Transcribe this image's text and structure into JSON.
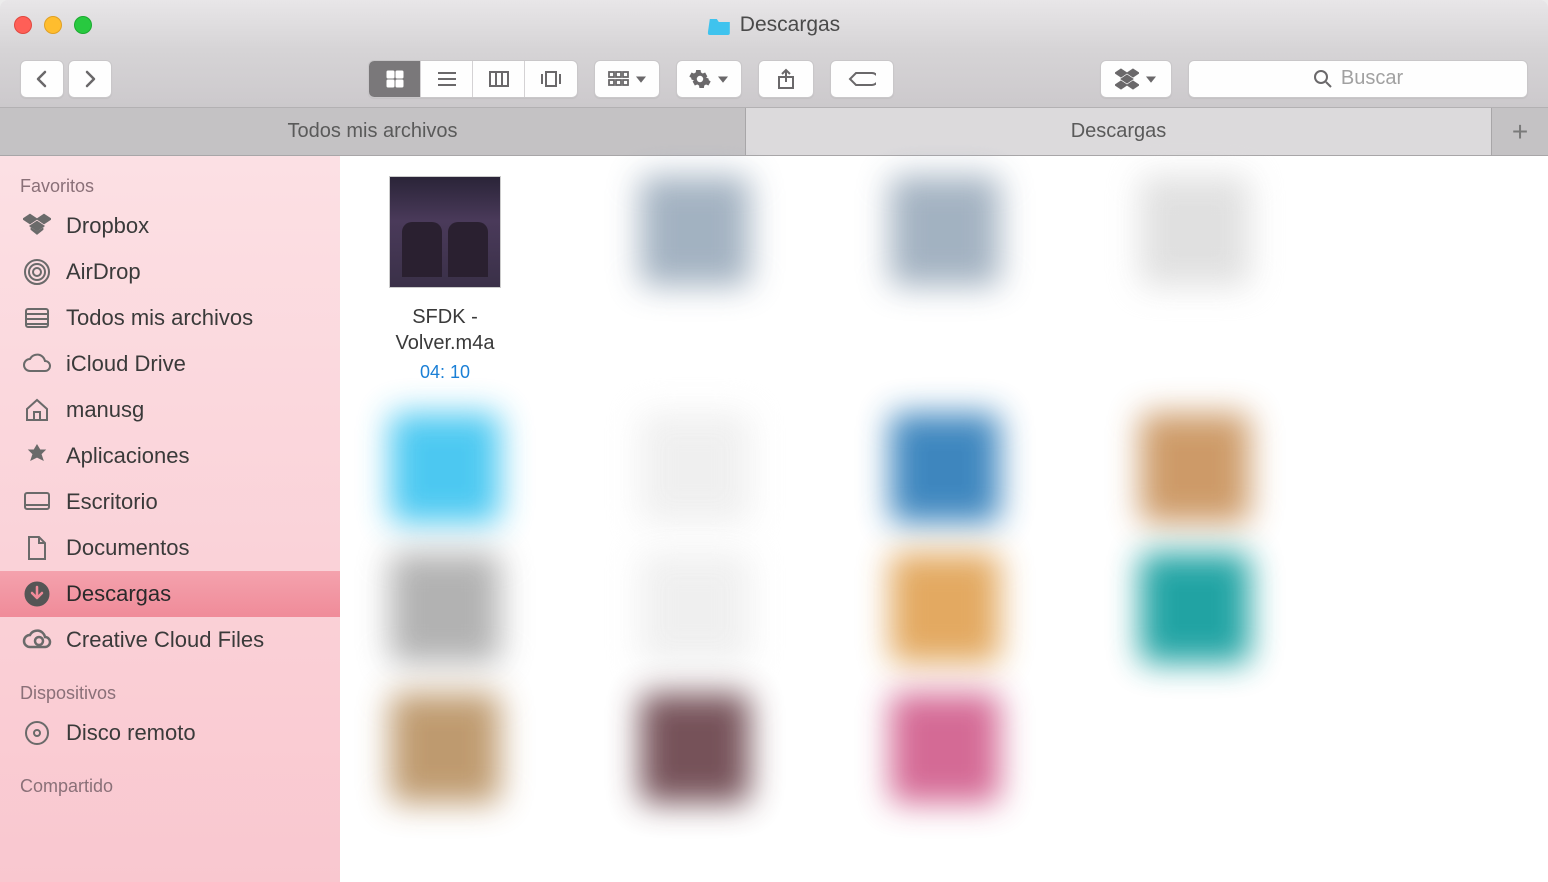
{
  "window": {
    "title": "Descargas"
  },
  "toolbar": {
    "search_placeholder": "Buscar"
  },
  "tabs": [
    {
      "label": "Todos mis archivos",
      "active": false
    },
    {
      "label": "Descargas",
      "active": true
    }
  ],
  "sidebar": {
    "sections": [
      {
        "title": "Favoritos",
        "items": [
          {
            "icon": "dropbox",
            "label": "Dropbox",
            "active": false
          },
          {
            "icon": "airdrop",
            "label": "AirDrop",
            "active": false
          },
          {
            "icon": "all-files",
            "label": "Todos mis archivos",
            "active": false
          },
          {
            "icon": "icloud",
            "label": "iCloud Drive",
            "active": false
          },
          {
            "icon": "home",
            "label": "manusg",
            "active": false
          },
          {
            "icon": "apps",
            "label": "Aplicaciones",
            "active": false
          },
          {
            "icon": "desktop",
            "label": "Escritorio",
            "active": false
          },
          {
            "icon": "documents",
            "label": "Documentos",
            "active": false
          },
          {
            "icon": "downloads",
            "label": "Descargas",
            "active": true
          },
          {
            "icon": "cc",
            "label": "Creative Cloud Files",
            "active": false
          }
        ]
      },
      {
        "title": "Dispositivos",
        "items": [
          {
            "icon": "disc",
            "label": "Disco remoto",
            "active": false
          }
        ]
      },
      {
        "title": "Compartido",
        "items": []
      }
    ]
  },
  "files": [
    {
      "name": "SFDK - Volver.m4a",
      "duration": "04: 10"
    }
  ]
}
